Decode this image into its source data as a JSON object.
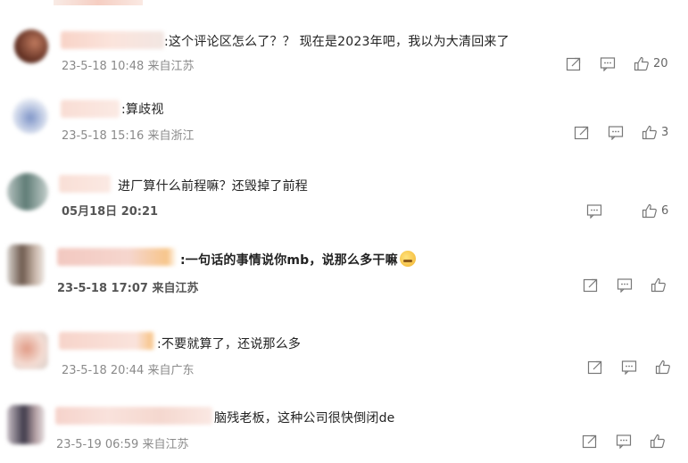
{
  "comments": [
    {
      "text": ":这个评论区怎么了？？ 现在是2023年吧，我以为大清回来了",
      "meta": "23-5-18 10:48 来自江苏",
      "likes": "20"
    },
    {
      "text": ":算歧视",
      "meta": "23-5-18 15:16 来自浙江",
      "likes": "3"
    },
    {
      "text": "进厂算什么前程嘛？还毁掉了前程",
      "meta": "05月18日 20:21",
      "likes": "6"
    },
    {
      "text": ":一句话的事情说你mb，说那么多干嘛",
      "meta": "23-5-18 17:07 来自江苏",
      "likes": ""
    },
    {
      "text": ":不要就算了，还说那么多",
      "meta": "23-5-18 20:44 来自广东",
      "likes": ""
    },
    {
      "text": "脑残老板，这种公司很快倒闭de",
      "meta": "23-5-19 06:59 来自江苏",
      "likes": ""
    }
  ],
  "icons": {
    "share": "share-icon",
    "comment": "comment-icon",
    "like": "thumbs-up-icon"
  },
  "colors": {
    "meta": "#8a8a8a",
    "icon": "#777777",
    "text": "#222222"
  }
}
